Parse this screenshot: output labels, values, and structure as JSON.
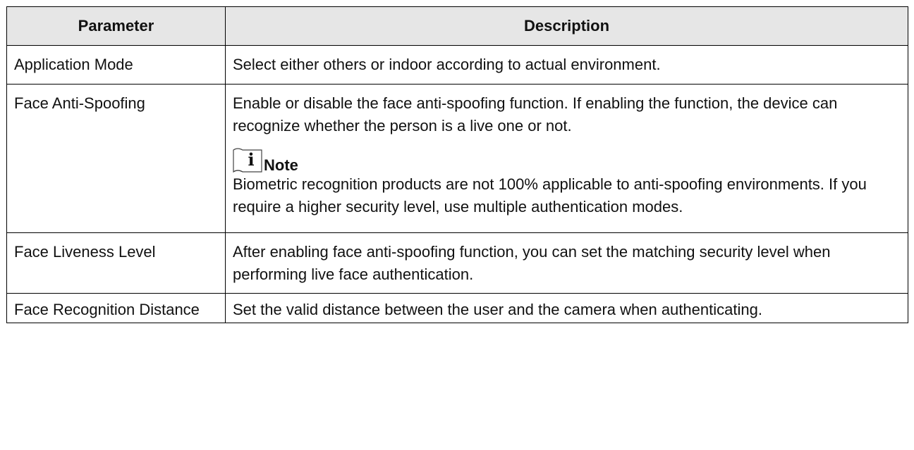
{
  "table": {
    "headers": {
      "parameter": "Parameter",
      "description": "Description"
    },
    "rows": [
      {
        "parameter": "Application Mode",
        "description": "Select either others or indoor according to actual environment."
      },
      {
        "parameter": "Face Anti-Spoofing",
        "description": "Enable or disable the face anti-spoofing function. If enabling the function, the device can recognize whether the person is a live one or not.",
        "note": {
          "icon": "info-note-icon",
          "label": "Note",
          "text": "Biometric recognition products are not 100% applicable to anti-spoofing environments. If you require a higher security level, use multiple authentication modes."
        }
      },
      {
        "parameter": "Face Liveness Level",
        "description": "After enabling face anti-spoofing function, you can set the matching security level when performing live face authentication."
      },
      {
        "parameter": "Face Recognition Distance",
        "description": "Set the valid distance between the user and the camera when authenticating."
      }
    ]
  }
}
